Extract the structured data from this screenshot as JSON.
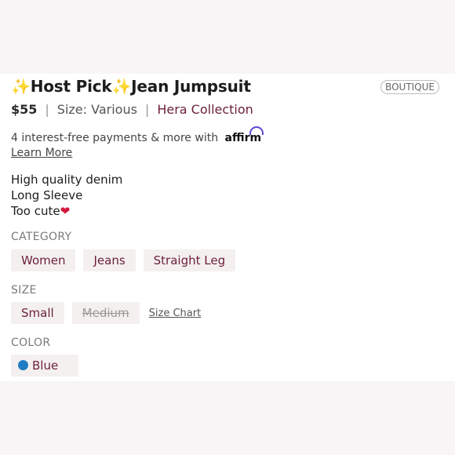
{
  "listing": {
    "title": "✨Host Pick✨Jean Jumpsuit",
    "badge": "BOUTIQUE",
    "price": "$55",
    "separator": "|",
    "size_text": "Size: Various",
    "brand": "Hera Collection"
  },
  "affirm": {
    "text": "4 interest-free payments & more with",
    "logo": "affirm",
    "learn_more": "Learn More",
    "brand_color": "#5a4bd6"
  },
  "description": [
    "High quality denim",
    "Long Sleeve",
    "Too cute"
  ],
  "description_emoji": "❤",
  "category": {
    "label": "CATEGORY",
    "items": [
      "Women",
      "Jeans",
      "Straight Leg"
    ]
  },
  "size": {
    "label": "SIZE",
    "options": [
      {
        "label": "Small",
        "available": true
      },
      {
        "label": "Medium",
        "available": false
      }
    ],
    "size_chart": "Size Chart"
  },
  "color": {
    "label": "COLOR",
    "value": "Blue",
    "swatch": "#1f7bc4"
  },
  "theme": {
    "accent": "#6b1f3a",
    "chip_bg": "#f4f0ef",
    "page_bg": "#f8f5f6"
  }
}
